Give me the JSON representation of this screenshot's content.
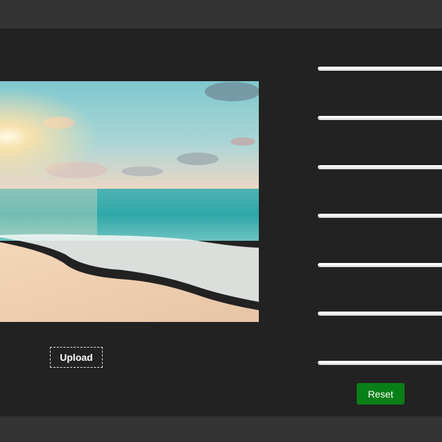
{
  "editor": {
    "upload_label": "Upload",
    "reset_label": "Reset",
    "sliders": [
      {
        "name": "slider-1"
      },
      {
        "name": "slider-2"
      },
      {
        "name": "slider-3"
      },
      {
        "name": "slider-4"
      },
      {
        "name": "slider-5"
      },
      {
        "name": "slider-6"
      },
      {
        "name": "slider-7"
      }
    ]
  },
  "colors": {
    "background": "#222222",
    "bars": "#333333",
    "reset_accent": "#0a7f17",
    "slider_track": "#e8e8e8"
  }
}
